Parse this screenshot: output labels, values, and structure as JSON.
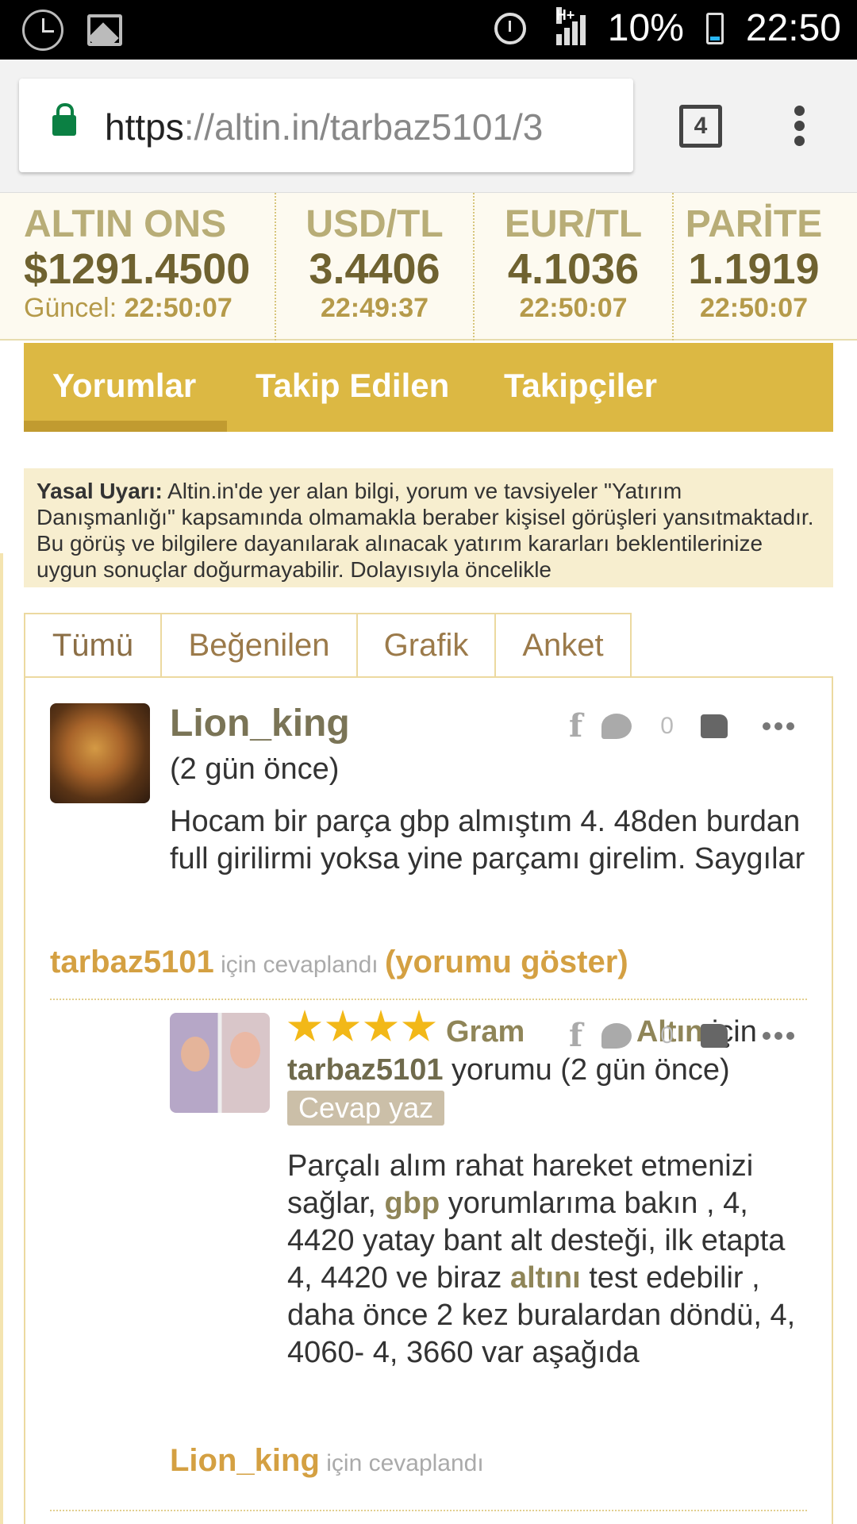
{
  "status_bar": {
    "battery": "10%",
    "time": "22:50",
    "network": "H+"
  },
  "browser": {
    "url_scheme": "https",
    "url_rest": "://altin.in/tarbaz5101/3",
    "tab_count": "4"
  },
  "ticker": [
    {
      "name": "ALTIN ONS",
      "price": "$1291.4500",
      "time_label": "Güncel:",
      "time": "22:50:07"
    },
    {
      "name": "USD/TL",
      "price": "3.4406",
      "time": "22:49:37"
    },
    {
      "name": "EUR/TL",
      "price": "4.1036",
      "time": "22:50:07"
    },
    {
      "name": "PARİTE",
      "price": "1.1919",
      "time": "22:50:07"
    }
  ],
  "main_tabs": [
    "Yorumlar",
    "Takip Edilen",
    "Takipçiler"
  ],
  "disclaimer": {
    "label": "Yasal Uyarı:",
    "text": "Altin.in'de yer alan bilgi, yorum ve tavsiyeler \"Yatırım Danışmanlığı\" kapsamında olmamakla beraber kişisel görüşleri yansıtmaktadır. Bu görüş ve bilgilere dayanılarak alınacak yatırım kararları beklentilerinize uygun sonuçlar doğurmayabilir. Dolayısıyla öncelikle"
  },
  "filter_tabs": [
    "Tümü",
    "Beğenilen",
    "Grafik",
    "Anket"
  ],
  "comment": {
    "user": "Lion_king",
    "ago": "(2 gün önce)",
    "likes": "0",
    "text": "Hocam bir parça gbp almıştım 4. 48den burdan full girilirmi yoksa yine parçamı girelim. Saygılar",
    "replied_to": "tarbaz5101",
    "replied_label": "için cevaplandı",
    "show_label": "(yorumu göster)"
  },
  "reply": {
    "rating_stars": 4,
    "topic_a": "Gram",
    "topic_b": "Altın",
    "for": "için",
    "user": "tarbaz5101",
    "rest": "yorumu (2 gün önce)",
    "reply_button": "Cevap yaz",
    "likes": "0",
    "text_1": "Parçalı alım rahat hareket etmenizi sağlar,",
    "hl_1": "gbp",
    "text_2": "yorumlarıma bakın , 4, 4420 yatay bant alt desteği, ilk etapta 4, 4420 ve biraz",
    "hl_2": "altını",
    "text_3": "test edebilir , daha önce 2 kez buralardan döndü, 4, 4060- 4, 3660 var aşağıda",
    "replied_to": "Lion_king",
    "replied_label": "için cevaplandı"
  }
}
